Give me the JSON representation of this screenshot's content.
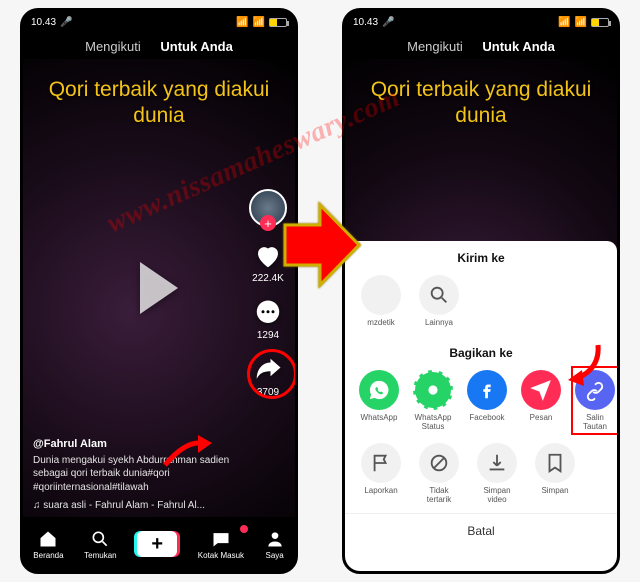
{
  "status": {
    "time": "10.43",
    "carrier": ""
  },
  "tabs": {
    "following": "Mengikuti",
    "foryou": "Untuk Anda"
  },
  "overlay_caption": "Qori terbaik yang diakui dunia",
  "counts": {
    "likes": "222.4K",
    "comments": "1294",
    "shares": "3709"
  },
  "meta": {
    "user": "@Fahrul Alam",
    "desc": "Dunia mengakui syekh Abdurrahman sadien sebagai qori terbaik dunia#qori #qoriinternasional#tilawah",
    "sound": "♫ suara asli - Fahrul Alam - Fahrul Al..."
  },
  "bottom": {
    "home": "Beranda",
    "discover": "Temukan",
    "inbox": "Kotak Masuk",
    "me": "Saya"
  },
  "sheet": {
    "send": "Kirim ke",
    "share": "Bagikan ke",
    "opts_send": {
      "mzdetik": "mzdetik",
      "more": "Lainnya"
    },
    "opts_share": {
      "whatsapp": "WhatsApp",
      "wa_status": "WhatsApp Status",
      "facebook": "Facebook",
      "dm": "Pesan",
      "copy": "Salin Tautan"
    },
    "opts_more": {
      "report": "Laporkan",
      "notint": "Tidak tertarik",
      "savevid": "Simpan video",
      "save": "Simpan"
    },
    "cancel": "Batal"
  },
  "watermark": "www.nissamaheswary.com"
}
